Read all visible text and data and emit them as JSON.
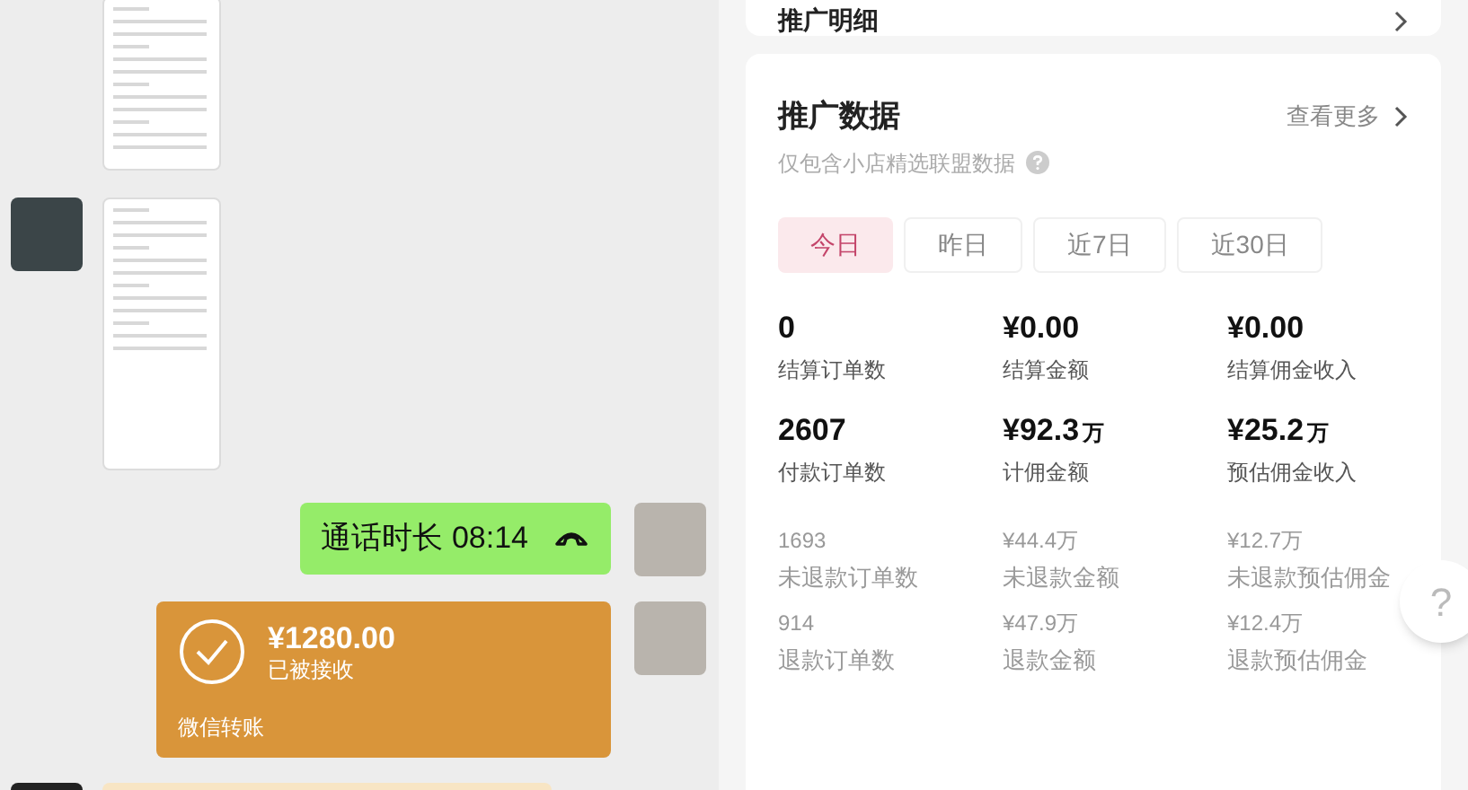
{
  "chat": {
    "call_message": {
      "text": "通话时长 08:14"
    },
    "transfer": {
      "amount": "¥1280.00",
      "status": "已被接收",
      "label": "微信转账"
    }
  },
  "detail_card": {
    "title": "推广明细"
  },
  "promo_data": {
    "title": "推广数据",
    "more": "查看更多",
    "subtitle": "仅包含小店精选联盟数据",
    "tabs": [
      {
        "label": "今日",
        "selected": true
      },
      {
        "label": "昨日",
        "selected": false
      },
      {
        "label": "近7日",
        "selected": false
      },
      {
        "label": "近30日",
        "selected": false
      }
    ],
    "main_stats": [
      {
        "value": "0",
        "label": "结算订单数"
      },
      {
        "value": "¥0.00",
        "label": "结算金额"
      },
      {
        "value": "¥0.00",
        "label": "结算佣金收入"
      },
      {
        "value": "2607",
        "label": "付款订单数"
      },
      {
        "value": "¥92.3",
        "unit": "万",
        "label": "计佣金额"
      },
      {
        "value": "¥25.2",
        "unit": "万",
        "label": "预估佣金收入"
      }
    ],
    "minor_stats": [
      {
        "value": "1693",
        "label": "未退款订单数"
      },
      {
        "value": "¥44.4万",
        "label": "未退款金额"
      },
      {
        "value": "¥12.7万",
        "label": "未退款预估佣金"
      },
      {
        "value": "914",
        "label": "退款订单数"
      },
      {
        "value": "¥47.9万",
        "label": "退款金额"
      },
      {
        "value": "¥12.4万",
        "label": "退款预估佣金"
      }
    ]
  },
  "help_button": {
    "text": "?"
  }
}
